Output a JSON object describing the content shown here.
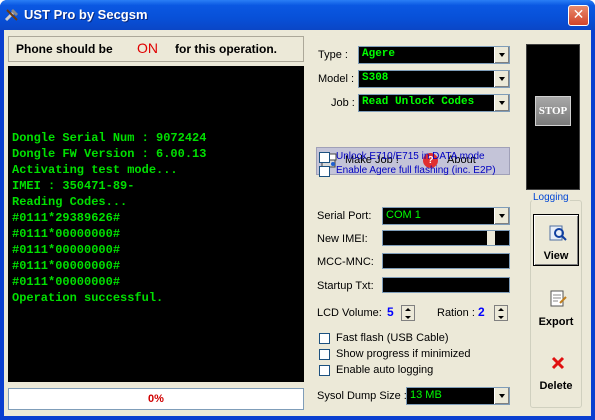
{
  "window": {
    "title": "UST Pro by Secgsm",
    "close_glyph": "✕"
  },
  "banner": {
    "pre": "Phone should be",
    "state": "ON",
    "post": "for this operation."
  },
  "console": {
    "lines": [
      "Dongle Serial Num : 9072424",
      "Dongle FW Version : 6.00.13",
      "Activating test mode...",
      "IMEI : 350471-89-",
      "Reading Codes...",
      "#0111*29389626#",
      "#0111*00000000#",
      "#0111*00000000#",
      "#0111*00000000#",
      "#0111*00000000#",
      "Operation successful."
    ]
  },
  "progress": {
    "text": "0%",
    "value": 0
  },
  "selectors": {
    "type_label": "Type :",
    "type_value": "Agere",
    "model_label": "Model :",
    "model_value": "S308",
    "job_label": "Job :",
    "job_value": "Read Unlock Codes"
  },
  "actions": {
    "make_job": "Make Job !",
    "about_glyph": "?",
    "about": "About"
  },
  "options_top": {
    "unlock_data_mode": "Unlock E710/E715 in DATA mode",
    "agere_full_flash": "Enable Agere full flashing (inc. E2P)"
  },
  "stop": {
    "label": "STOP"
  },
  "settings": {
    "serial_port_label": "Serial Port:",
    "serial_port_value": "COM 1",
    "new_imei_label": "New IMEI:",
    "mcc_mnc_label": "MCC-MNC:",
    "startup_txt_label": "Startup Txt:",
    "lcd_volume_label": "LCD Volume:",
    "lcd_volume_value": "5",
    "ration_label": "Ration :",
    "ration_value": "2",
    "fast_flash": "Fast flash (USB Cable)",
    "show_progress": "Show progress if minimized",
    "auto_logging": "Enable auto logging",
    "sysol_dump_label": "Sysol Dump Size :",
    "sysol_dump_value": "13 MB"
  },
  "logging": {
    "title": "Logging",
    "view": "View",
    "export": "Export",
    "delete": "Delete"
  },
  "colors": {
    "console_text": "#00e000",
    "banner_on": "#e00000",
    "progress_text": "#d00000",
    "checkbox_text_blue": "#0000c0"
  }
}
